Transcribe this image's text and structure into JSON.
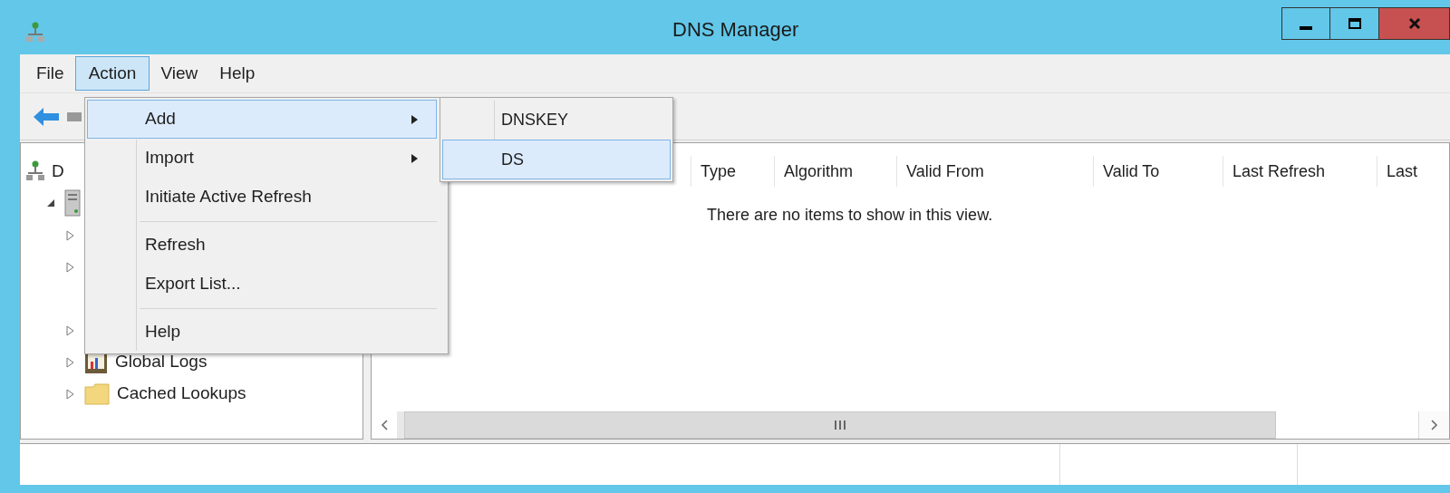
{
  "window": {
    "title": "DNS Manager"
  },
  "menu_bar": [
    {
      "label": "File",
      "selected": false
    },
    {
      "label": "Action",
      "selected": true
    },
    {
      "label": "View",
      "selected": false
    },
    {
      "label": "Help",
      "selected": false
    }
  ],
  "tree": [
    {
      "label": "D",
      "kind": "dns",
      "children": [
        {
          "kind": "server",
          "expanded": true,
          "children": [
            {
              "kind": "hidden",
              "expanded": false
            },
            {
              "kind": "hidden",
              "expanded": false
            },
            {
              "kind": "gap"
            },
            {
              "kind": "hidden",
              "expanded": false
            },
            {
              "label": "Global Logs",
              "kind": "logs",
              "expanded": false
            },
            {
              "label": "Cached Lookups",
              "kind": "folder",
              "expanded": false
            }
          ]
        }
      ]
    }
  ],
  "table": {
    "columns": [
      "Type",
      "Algorithm",
      "Valid From",
      "Valid To",
      "Last Refresh",
      "Last"
    ],
    "empty_message": "There are no items to show in this view."
  },
  "action_menu": [
    {
      "kind": "item",
      "label": "Add",
      "submenu": true,
      "selected": true
    },
    {
      "kind": "item",
      "label": "Import",
      "submenu": true,
      "selected": false
    },
    {
      "kind": "item",
      "label": "Initiate Active Refresh",
      "submenu": false,
      "selected": false
    },
    {
      "kind": "separator"
    },
    {
      "kind": "item",
      "label": "Refresh",
      "submenu": false,
      "selected": false
    },
    {
      "kind": "item",
      "label": "Export List...",
      "submenu": false,
      "selected": false
    },
    {
      "kind": "separator"
    },
    {
      "kind": "item",
      "label": "Help",
      "submenu": false,
      "selected": false
    }
  ],
  "add_submenu": [
    {
      "label": "DNSKEY",
      "selected": false
    },
    {
      "label": "DS",
      "selected": true
    }
  ]
}
